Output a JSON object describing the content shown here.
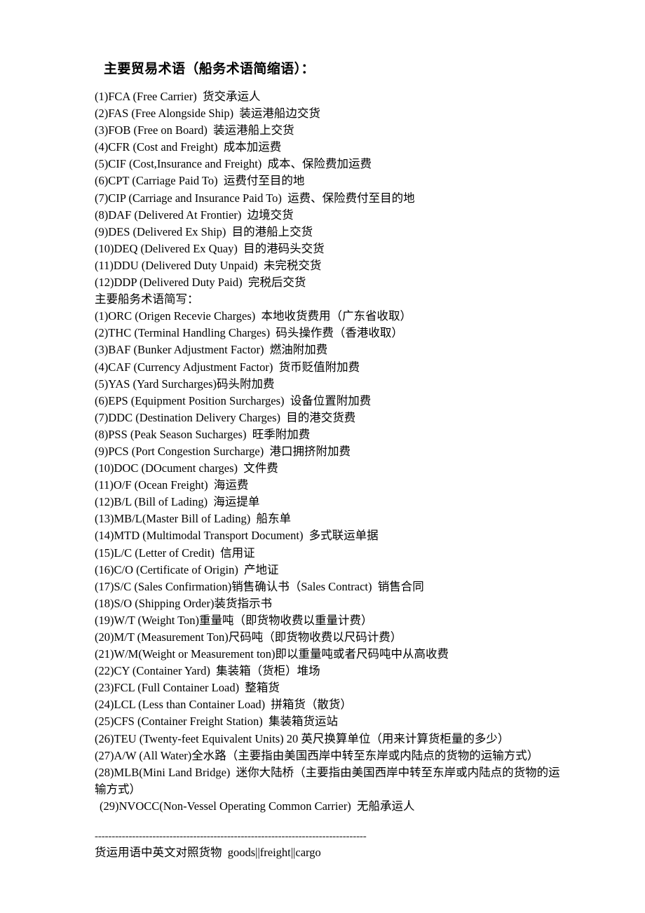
{
  "document": {
    "title": "主要贸易术语（船务术语简缩语）：",
    "trade_terms": [
      "(1)FCA (Free Carrier)  货交承运人",
      "(2)FAS (Free Alongside Ship)  装运港船边交货",
      "(3)FOB (Free on Board)  装运港船上交货",
      "(4)CFR (Cost and Freight)  成本加运费",
      "(5)CIF (Cost,Insurance and Freight)  成本、保险费加运费",
      "(6)CPT (Carriage Paid To)  运费付至目的地",
      "(7)CIP (Carriage and Insurance Paid To)  运费、保险费付至目的地",
      "(8)DAF (Delivered At Frontier)  边境交货",
      "(9)DES (Delivered Ex Ship)  目的港船上交货",
      "(10)DEQ (Delivered Ex Quay)  目的港码头交货",
      "(11)DDU (Delivered Duty Unpaid)  未完税交货",
      "(12)DDP (Delivered Duty Paid)  完税后交货"
    ],
    "section_label": "主要船务术语简写：",
    "shipping_terms": [
      "(1)ORC (Origen Recevie Charges)  本地收货费用（广东省收取）",
      "(2)THC (Terminal Handling Charges)  码头操作费（香港收取）",
      "(3)BAF (Bunker Adjustment Factor)  燃油附加费",
      "(4)CAF (Currency Adjustment Factor)  货币贬值附加费",
      "(5)YAS (Yard Surcharges)码头附加费",
      "(6)EPS (Equipment Position Surcharges)  设备位置附加费",
      "(7)DDC (Destination Delivery Charges)  目的港交货费",
      "(8)PSS (Peak Season Sucharges)  旺季附加费",
      "(9)PCS (Port Congestion Surcharge)  港口拥挤附加费",
      "(10)DOC (DOcument charges)  文件费",
      "(11)O/F (Ocean Freight)  海运费",
      "(12)B/L (Bill of Lading)  海运提单",
      "(13)MB/L(Master Bill of Lading)  船东单",
      "(14)MTD (Multimodal Transport Document)  多式联运单据",
      "(15)L/C (Letter of Credit)  信用证",
      "(16)C/O (Certificate of Origin)  产地证",
      "(17)S/C (Sales Confirmation)销售确认书（Sales Contract)  销售合同",
      "(18)S/O (Shipping Order)装货指示书",
      "(19)W/T (Weight Ton)重量吨（即货物收费以重量计费）",
      "(20)M/T (Measurement Ton)尺码吨（即货物收费以尺码计费）",
      "(21)W/M(Weight or Measurement ton)即以重量吨或者尺码吨中从高收费",
      "(22)CY (Container Yard)  集装箱（货柜）堆场",
      "(23)FCL (Full Container Load)  整箱货",
      "(24)LCL (Less than Container Load)  拼箱货（散货）",
      "(25)CFS (Container Freight Station)  集装箱货运站",
      "(26)TEU (Twenty-feet Equivalent Units) 20 英尺换算单位（用来计算货柜量的多少）",
      "(27)A/W (All Water)全水路（主要指由美国西岸中转至东岸或内陆点的货物的运输方式）",
      "(28)MLB(Mini Land Bridge)  迷你大陆桥（主要指由美国西岸中转至东岸或内陆点的货物的运输方式）"
    ],
    "shipping_terms_indented": [
      "(29)NVOCC(Non-Vessel Operating Common Carrier)  无船承运人"
    ],
    "separator_rule": "--------------------------------------------------------------------------------",
    "footer_line": "货运用语中英文对照货物  goods||freight||cargo"
  }
}
